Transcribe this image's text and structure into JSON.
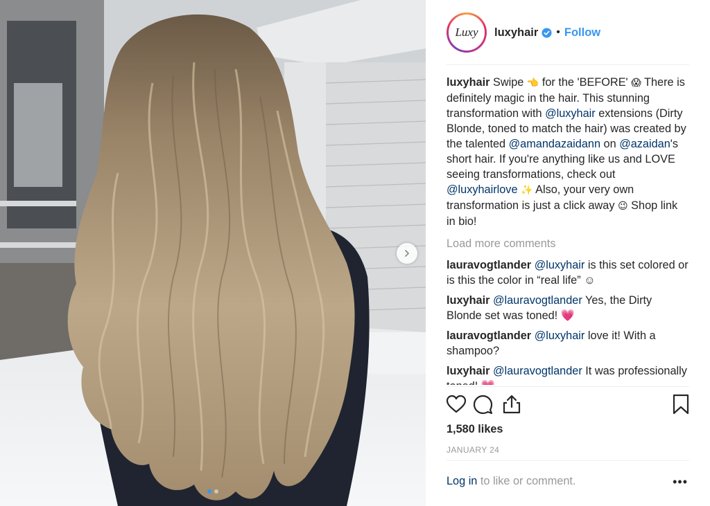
{
  "post": {
    "username": "luxyhair",
    "avatar_text": "Luxy",
    "follow_label": "Follow",
    "separator": "•",
    "caption": {
      "author": "luxyhair",
      "part1": " Swipe ",
      "emoji1": "👈",
      "part2": "  for the 'BEFORE' ",
      "emoji2": "😱",
      "part3": " There is definitely magic in the hair. This stunning transformation with ",
      "mention1": "@luxyhair",
      "part4": " extensions (Dirty Blonde, toned to match the hair) was created by the talented ",
      "mention2": "@amandazaidann",
      "part5": " on ",
      "mention3": "@azaidan",
      "part6": "'s short hair. If you're anything like us and LOVE seeing transformations, check out ",
      "mention4": "@luxyhairlove",
      "emoji3": "✨",
      "part7": "  Also, your very own transformation is just a click away ",
      "emoji4": "😉",
      "part8": "  Shop link in bio!"
    },
    "load_more": "Load more comments",
    "comments": [
      {
        "author": "lauravogtlander",
        "mention": "@luxyhair",
        "text": " is this set colored or is this the color in “real life” ☺"
      },
      {
        "author": "luxyhair",
        "mention": "@lauravogtlander",
        "text": " Yes, the Dirty Blonde set was toned! 💗"
      },
      {
        "author": "lauravogtlander",
        "mention": "@luxyhair",
        "text": " love it! With a shampoo?"
      },
      {
        "author": "luxyhair",
        "mention": "@lauravogtlander",
        "text": " It was professionally toned! 💗"
      }
    ],
    "likes": "1,580 likes",
    "date": "JANUARY 24",
    "footer": {
      "login": "Log in",
      "rest": " to like or comment.",
      "more": "•••"
    },
    "carousel": {
      "current": 1,
      "total": 2
    }
  },
  "colors": {
    "link": "#3897f0",
    "mention": "#003569",
    "muted": "#999999",
    "text": "#262626"
  },
  "icons": [
    "verified-badge-icon",
    "chevron-right-icon",
    "heart-icon",
    "comment-icon",
    "share-icon",
    "bookmark-icon",
    "more-options-icon"
  ]
}
